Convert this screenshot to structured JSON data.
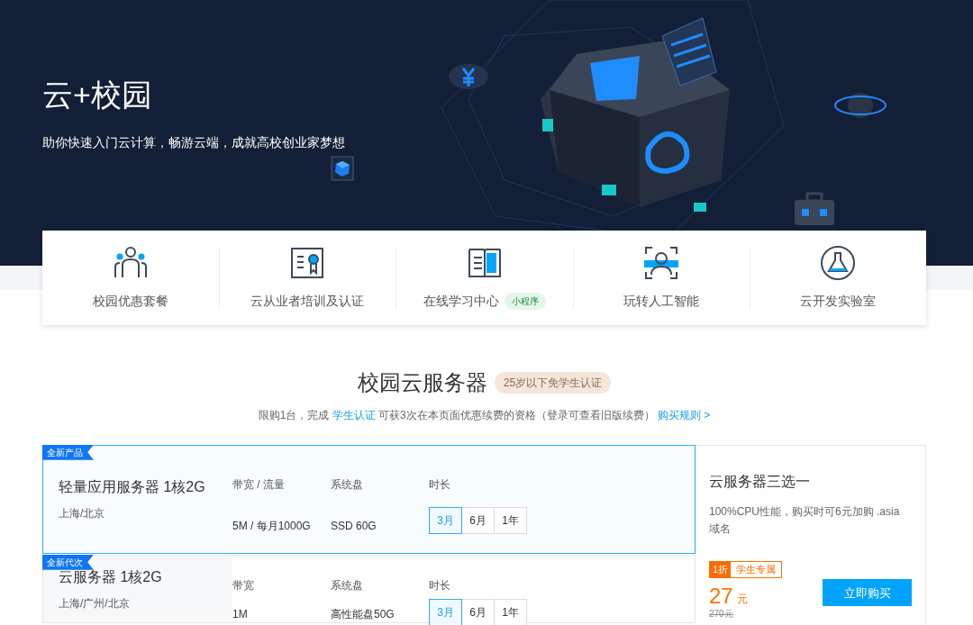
{
  "hero": {
    "title": "云+校园",
    "subtitle": "助你快速入门云计算，畅游云端，成就高校创业家梦想"
  },
  "features": [
    {
      "label": "校园优惠套餐"
    },
    {
      "label": "云从业者培训及认证"
    },
    {
      "label": "在线学习中心",
      "tag": "小程序"
    },
    {
      "label": "玩转人工智能"
    },
    {
      "label": "云开发实验室"
    }
  ],
  "section": {
    "title": "校园云服务器",
    "badge": "25岁以下免学生认证",
    "notice": [
      {
        "kind": "text",
        "text": "限购1台，完成 "
      },
      {
        "kind": "link",
        "text": "学生认证"
      },
      {
        "kind": "text",
        "text": " 可获3次在本页面优惠续费的资格（登录可查看旧版续费） "
      },
      {
        "kind": "link",
        "text": "购买规则 >"
      }
    ]
  },
  "products": [
    {
      "tag": "全新产品",
      "name": "轻量应用服务器 1核2G",
      "location": "上海/北京",
      "selected": true,
      "specs": [
        {
          "label": "带宽 / 流量",
          "value": "5M / 每月1000G"
        },
        {
          "label": "系统盘",
          "value": "SSD 60G"
        }
      ],
      "duration_label": "时长",
      "durations": [
        {
          "label": "3月",
          "selected": true
        },
        {
          "label": "6月",
          "selected": false
        },
        {
          "label": "1年",
          "selected": false
        }
      ]
    },
    {
      "tag": "全新代次",
      "name": "云服务器 1核2G",
      "location": "上海/广州/北京",
      "selected": false,
      "specs": [
        {
          "label": "带宽",
          "value": "1M"
        },
        {
          "label": "系统盘",
          "value": "高性能盘50G"
        }
      ],
      "duration_label": "时长",
      "durations": [
        {
          "label": "3月",
          "selected": true
        },
        {
          "label": "6月",
          "selected": false
        },
        {
          "label": "1年",
          "selected": false
        }
      ]
    }
  ],
  "offer": {
    "title": "云服务器三选一",
    "description": "100%CPU性能，购买时可6元加购 .asia 域名",
    "discount": "1折",
    "discount_label": "学生专属",
    "price": "27",
    "unit": "元",
    "original_price": "270元",
    "button": "立即购买"
  }
}
